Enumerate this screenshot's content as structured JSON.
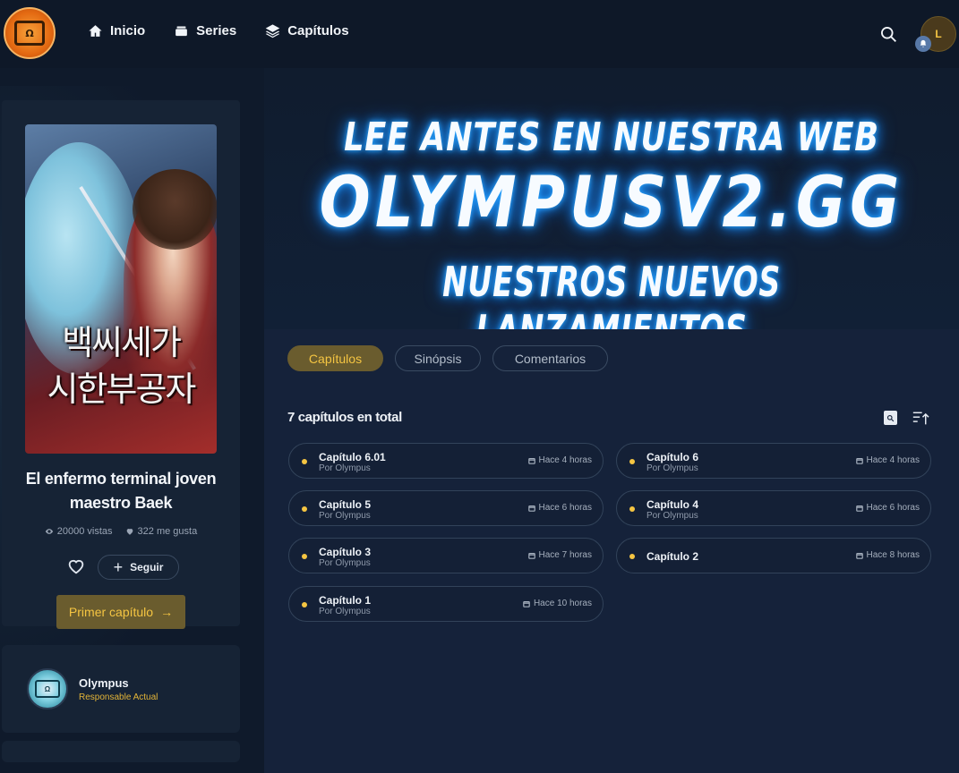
{
  "brand": {
    "logo_text": "OLYMPUS"
  },
  "nav": [
    {
      "label": "Inicio",
      "icon": "home-icon"
    },
    {
      "label": "Series",
      "icon": "layers-icon"
    },
    {
      "label": "Capítulos",
      "icon": "stack-icon"
    }
  ],
  "user": {
    "avatar_initial": "L"
  },
  "series": {
    "cover_title": "백씨세가\n시한부공자",
    "title": "El enfermo terminal joven maestro Baek",
    "views": "20000 vistas",
    "likes": "322 me gusta",
    "follow_label": "Seguir",
    "first_chapter_label": "Primer capítulo"
  },
  "group": {
    "name": "Olympus",
    "role": "Responsable Actual",
    "avatar_text": "OLYMPUS"
  },
  "banner": {
    "line1": "LEE ANTES EN NUESTRA WEB",
    "line2": "OLYMPUSV2.GG",
    "line3": "NUESTROS NUEVOS LANZAMIENTOS"
  },
  "tabs": {
    "chapters": "Capítulos",
    "synopsis": "Sinópsis",
    "comments": "Comentarios"
  },
  "chapters_total": "7 capítulos en total",
  "chapters": [
    {
      "name": "Capítulo 6.01",
      "by": "Por Olympus",
      "time": "Hace 4 horas"
    },
    {
      "name": "Capítulo 6",
      "by": "Por Olympus",
      "time": "Hace 4 horas"
    },
    {
      "name": "Capítulo 5",
      "by": "Por Olympus",
      "time": "Hace 6 horas"
    },
    {
      "name": "Capítulo 4",
      "by": "Por Olympus",
      "time": "Hace 6 horas"
    },
    {
      "name": "Capítulo 3",
      "by": "Por Olympus",
      "time": "Hace 7 horas"
    },
    {
      "name": "Capítulo 2",
      "by": "",
      "time": "Hace 8 horas"
    },
    {
      "name": "Capítulo 1",
      "by": "Por Olympus",
      "time": "Hace 10 horas"
    }
  ],
  "colors": {
    "accent": "#f5c542",
    "accent_bg": "#6a5c2e",
    "page_bg": "#0f1a2b",
    "panel_bg": "#15223a"
  }
}
